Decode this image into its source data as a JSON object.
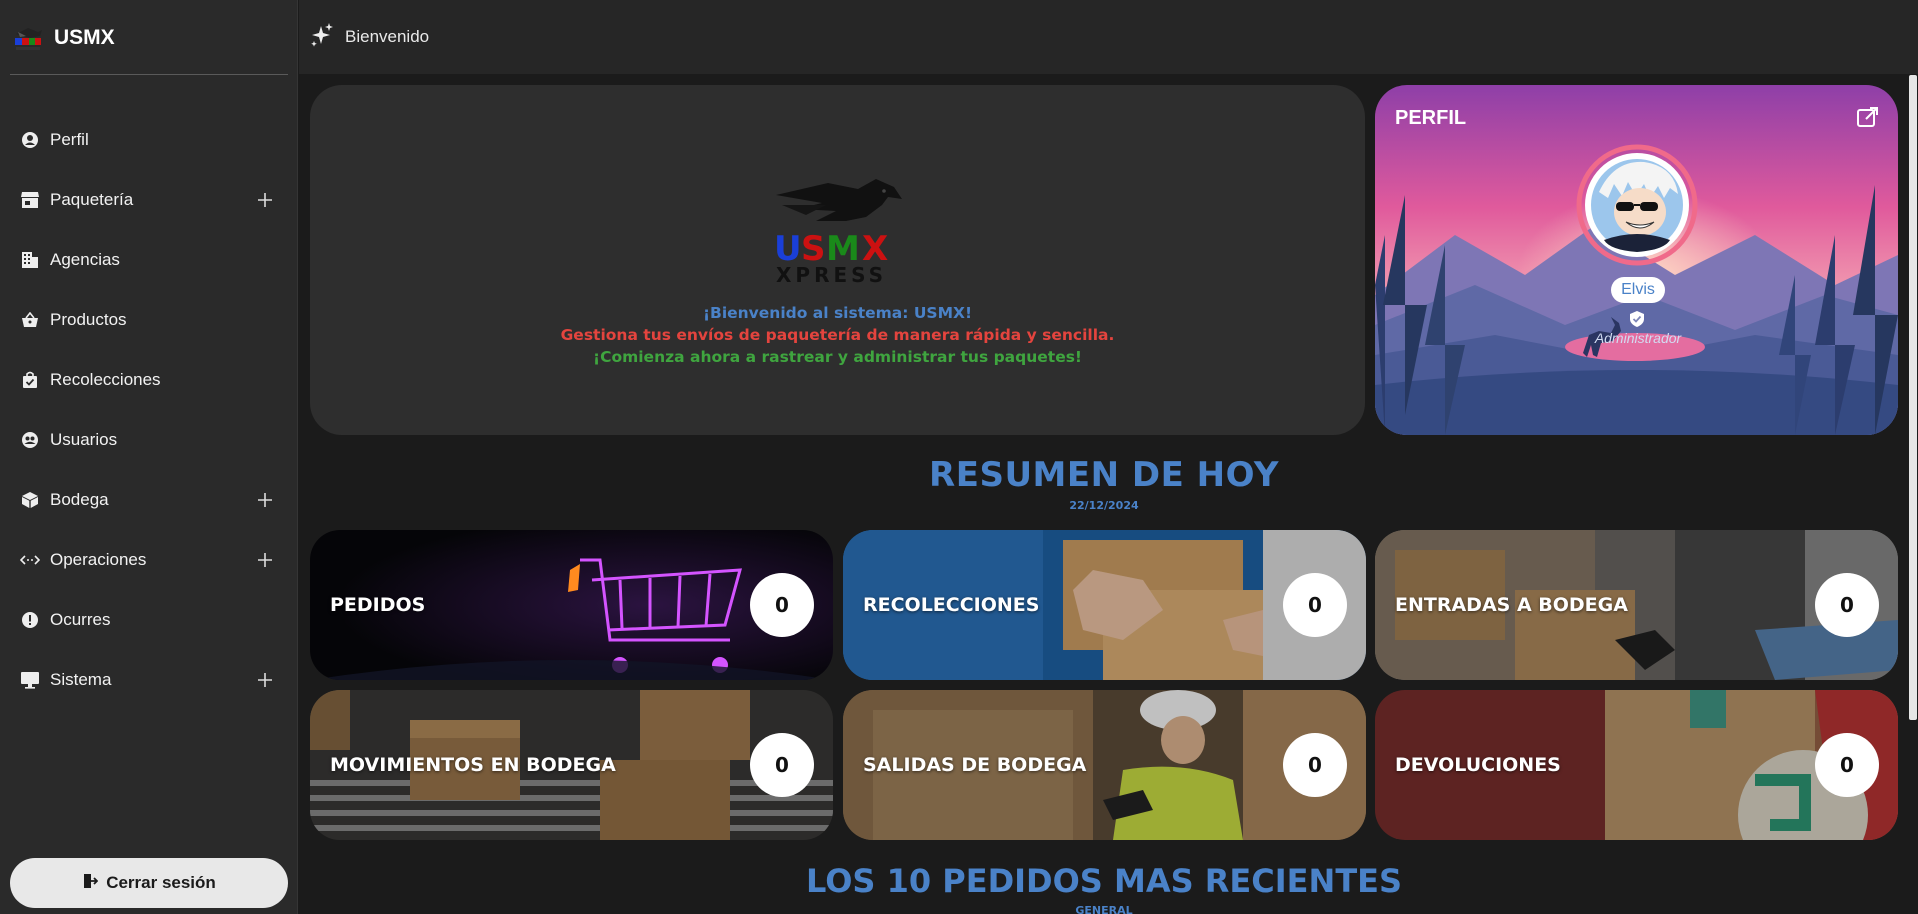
{
  "brand": {
    "title": "USMX",
    "logo_icon": "usmx-logo"
  },
  "sidebar": {
    "items": [
      {
        "label": "Perfil",
        "icon": "user-circle-icon",
        "expandable": false
      },
      {
        "label": "Paquetería",
        "icon": "store-icon",
        "expandable": true
      },
      {
        "label": "Agencias",
        "icon": "building-icon",
        "expandable": false
      },
      {
        "label": "Productos",
        "icon": "basket-icon",
        "expandable": false
      },
      {
        "label": "Recolecciones",
        "icon": "bag-check-icon",
        "expandable": false
      },
      {
        "label": "Usuarios",
        "icon": "users-icon",
        "expandable": false
      },
      {
        "label": "Bodega",
        "icon": "box-icon",
        "expandable": true
      },
      {
        "label": "Operaciones",
        "icon": "arrows-code-icon",
        "expandable": true
      },
      {
        "label": "Ocurres",
        "icon": "alert-circle-icon",
        "expandable": false
      },
      {
        "label": "Sistema",
        "icon": "monitor-icon",
        "expandable": true
      }
    ],
    "logout_label": "Cerrar sesión"
  },
  "topbar": {
    "title": "Bienvenido",
    "icon": "sparkles-icon"
  },
  "welcome": {
    "line1": "¡Bienvenido al sistema: USMX!",
    "line2": "Gestiona tus envíos de paquetería de manera rápida y sencilla.",
    "line3": "¡Comienza ahora a rastrear y administrar tus paquetes!",
    "logo_text": "USMX",
    "logo_subtext": "XPRESS"
  },
  "profile": {
    "title": "PERFIL",
    "name": "Elvis",
    "role": "Administrador"
  },
  "summary": {
    "title": "RESUMEN DE HOY",
    "date": "22/12/2024",
    "cards": [
      {
        "label": "PEDIDOS",
        "count": "0"
      },
      {
        "label": "RECOLECCIONES",
        "count": "0"
      },
      {
        "label": "ENTRADAS A BODEGA",
        "count": "0"
      },
      {
        "label": "MOVIMIENTOS EN BODEGA",
        "count": "0"
      },
      {
        "label": "SALIDAS DE BODEGA",
        "count": "0"
      },
      {
        "label": "DEVOLUCIONES",
        "count": "0"
      }
    ]
  },
  "recent": {
    "title": "LOS 10 PEDIDOS MAS RECIENTES",
    "subtitle": "GENERAL"
  },
  "colors": {
    "accent": "#4a82c8",
    "red": "#e4443e",
    "green": "#3fa53f"
  }
}
